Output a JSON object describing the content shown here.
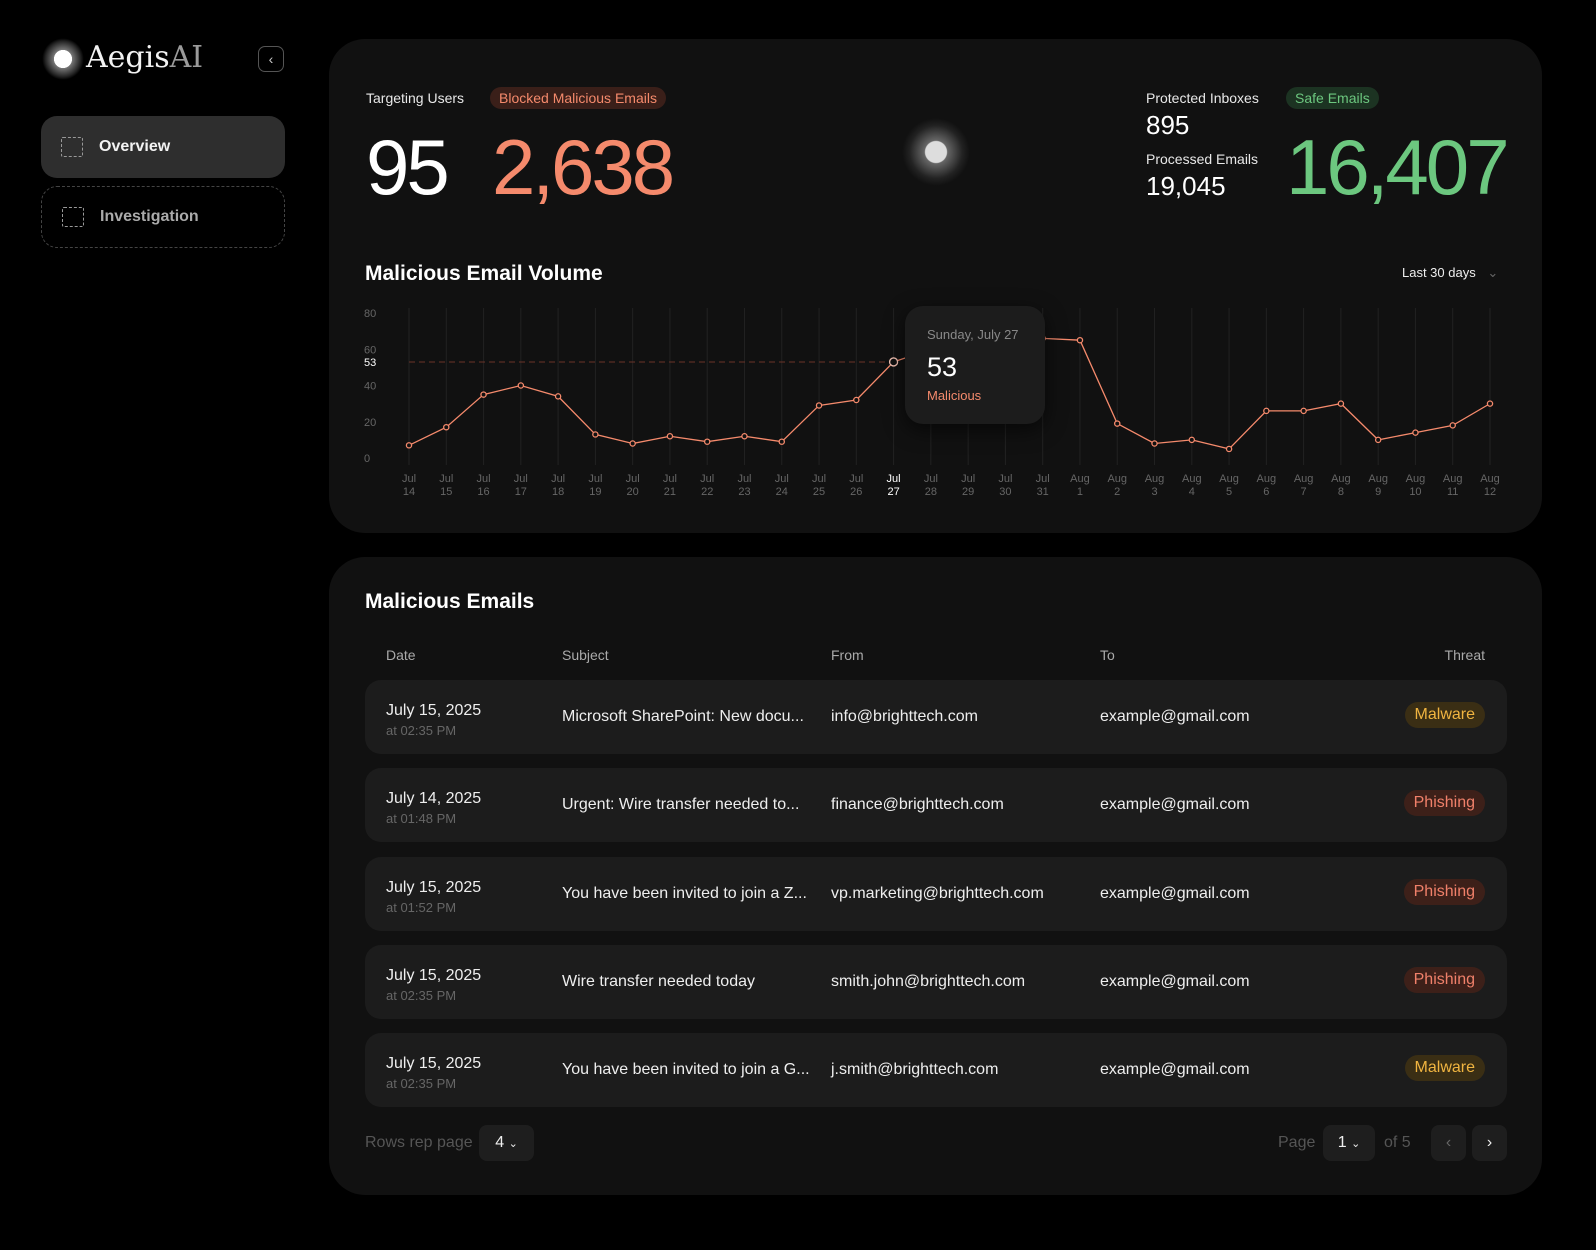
{
  "brand": {
    "name": "Aegis",
    "suffix": "AI"
  },
  "sidebar": {
    "items": [
      {
        "label": "Overview",
        "active": true,
        "icon": "grid-icon"
      },
      {
        "label": "Investigation",
        "active": false,
        "icon": "mail-search-icon"
      }
    ]
  },
  "stats": {
    "targeting_users_label": "Targeting Users",
    "targeting_users": "95",
    "blocked_label": "Blocked Malicious Emails",
    "blocked": "2,638",
    "protected_label": "Protected Inboxes",
    "protected": "895",
    "processed_label": "Processed Emails",
    "processed": "19,045",
    "safe_label": "Safe Emails",
    "safe": "16,407"
  },
  "colors": {
    "accent": "#f58a6c",
    "safe": "#6cc77f",
    "malware": "#f0b440",
    "phishing": "#f0806a"
  },
  "chart_section": {
    "title": "Malicious Email Volume",
    "range": "Last 30 days"
  },
  "chart_data": {
    "type": "line",
    "x": [
      "Jul 14",
      "Jul 15",
      "Jul 16",
      "Jul 17",
      "Jul 18",
      "Jul 19",
      "Jul 20",
      "Jul 21",
      "Jul 22",
      "Jul 23",
      "Jul 24",
      "Jul 25",
      "Jul 26",
      "Jul 27",
      "Jul 28",
      "Jul 29",
      "Jul 30",
      "Jul 31",
      "Aug 1",
      "Aug 2",
      "Aug 3",
      "Aug 4",
      "Aug 5",
      "Aug 6",
      "Aug 7",
      "Aug 8",
      "Aug 9",
      "Aug 10",
      "Aug 11",
      "Aug 12"
    ],
    "series": [
      {
        "name": "Malicious",
        "values": [
          7,
          17,
          35,
          40,
          34,
          13,
          8,
          12,
          9,
          12,
          9,
          29,
          32,
          53,
          60,
          63,
          65,
          66,
          65,
          19,
          8,
          10,
          5,
          26,
          26,
          30,
          10,
          14,
          18,
          30
        ]
      }
    ],
    "yticks": [
      0,
      20,
      40,
      60,
      80
    ],
    "ylim": [
      0,
      80
    ],
    "highlight": {
      "index": 13,
      "value": "53"
    },
    "tooltip": {
      "date": "Sunday, July 27",
      "value": "53",
      "series": "Malicious"
    }
  },
  "table": {
    "title": "Malicious Emails",
    "columns": [
      "Date",
      "Subject",
      "From",
      "To",
      "Threat"
    ],
    "rows": [
      {
        "date": "July 15, 2025",
        "time": "at 02:35 PM",
        "subject": "Microsoft SharePoint: New docu...",
        "from": "info@brighttech.com",
        "to": "example@gmail.com",
        "threat": "Malware"
      },
      {
        "date": "July 14, 2025",
        "time": "at 01:48 PM",
        "subject": "Urgent: Wire transfer needed to...",
        "from": "finance@brighttech.com",
        "to": "example@gmail.com",
        "threat": "Phishing"
      },
      {
        "date": "July 15, 2025",
        "time": "at 01:52 PM",
        "subject": "You have been invited to join a Z...",
        "from": "vp.marketing@brighttech.com",
        "to": "example@gmail.com",
        "threat": "Phishing"
      },
      {
        "date": "July 15, 2025",
        "time": "at 02:35 PM",
        "subject": "Wire transfer needed today",
        "from": "smith.john@brighttech.com",
        "to": "example@gmail.com",
        "threat": "Phishing"
      },
      {
        "date": "July 15, 2025",
        "time": "at 02:35 PM",
        "subject": "You have been invited to join a G...",
        "from": "j.smith@brighttech.com",
        "to": "example@gmail.com",
        "threat": "Malware"
      }
    ]
  },
  "pagination": {
    "rows_label": "Rows rep page",
    "rows_value": "4",
    "page_label": "Page",
    "page_value": "1",
    "of_label": "of 5"
  }
}
